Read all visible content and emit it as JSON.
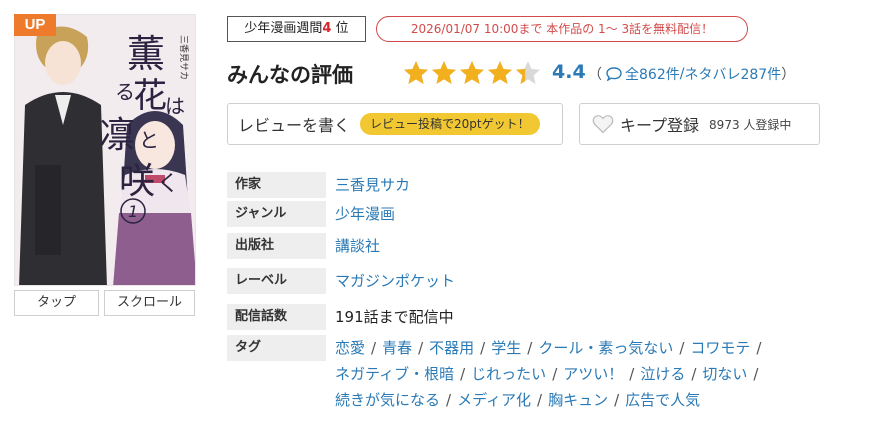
{
  "cover": {
    "badge": "UP",
    "title_chars": [
      "薫",
      "る",
      "花",
      "は",
      "凛",
      "と",
      "咲",
      "く"
    ],
    "author_vertical": "三香見サカ",
    "volume": "1",
    "view_buttons": [
      "タップ",
      "スクロール"
    ]
  },
  "ranking": {
    "label": "少年漫画週間",
    "rank": "4",
    "suffix": " 位"
  },
  "free_notice": "2026/01/07 10:00まで 本作品の 1～ 3話を無料配信！",
  "review": {
    "heading": "みんなの評価",
    "rating": "4.4",
    "stars_fraction": 0.88,
    "open_paren": "（",
    "all_count": "全862件",
    "slash": "/",
    "spoiler_count": "ネタバレ287件",
    "close_paren": "）"
  },
  "buttons": {
    "write_review": "レビューを書く",
    "points": "レビュー投稿で20ptゲット！",
    "keep": "キープ登録",
    "keep_count": "8973 人登録中"
  },
  "info": {
    "author_label": "作家",
    "author": "三香見サカ",
    "genre_label": "ジャンル",
    "genre": "少年漫画",
    "publisher_label": "出版社",
    "publisher": "講談社",
    "label_label": "レーベル",
    "label": "マガジンポケット",
    "episodes_label": "配信話数",
    "episodes": "191話まで配信中",
    "tags_label": "タグ",
    "tags_line1": [
      "恋愛",
      "青春",
      "不器用",
      "学生",
      "クール・素っ気ない",
      "コワモテ"
    ],
    "tags_line2": [
      "ネガティブ・根暗",
      "じれったい",
      "アツい！",
      "泣ける",
      "切ない"
    ],
    "tags_line3": [
      "続きが気になる",
      "メディア化",
      "胸キュン",
      "広告で人気"
    ],
    "separator": "/"
  },
  "colors": {
    "link": "#2b7ab5",
    "star": "#f2b01e",
    "up_badge": "#ee7b2c",
    "notice_red": "#d24b4b",
    "points_pill": "#f2c832"
  }
}
